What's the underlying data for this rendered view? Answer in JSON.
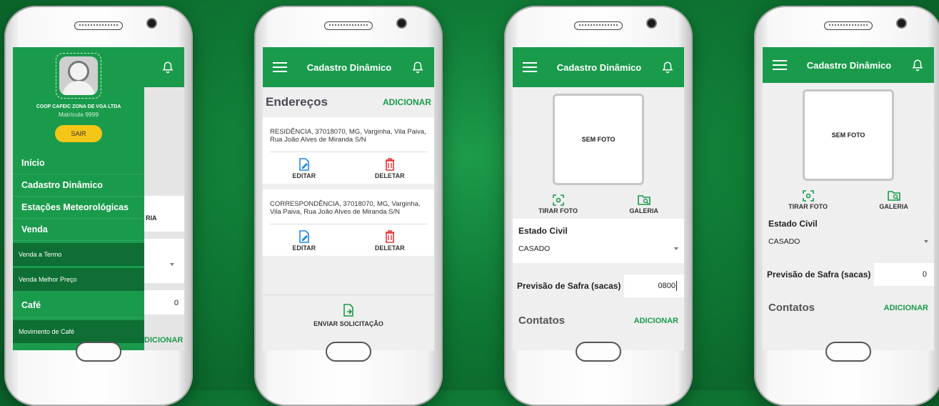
{
  "theme": {
    "primary": "#1a9b4c",
    "accent_button": "#f5c518",
    "delete_icon": "#e53935",
    "edit_icon": "#1e88e5"
  },
  "phone1": {
    "drawer": {
      "company": "COOP CAFEIC ZONA DE VGA LTDA",
      "matricula": "Matrícula 9999",
      "logout_label": "SAIR",
      "items": [
        {
          "label": "Início",
          "type": "main"
        },
        {
          "label": "Cadastro Dinâmico",
          "type": "main"
        },
        {
          "label": "Estações Meteorológicas",
          "type": "main"
        },
        {
          "label": "Venda",
          "type": "main"
        },
        {
          "label": "Venda a Termo",
          "type": "sub"
        },
        {
          "label": "Venda Melhor Preço",
          "type": "sub"
        },
        {
          "label": "Café",
          "type": "main"
        },
        {
          "label": "Movimento de Café",
          "type": "sub"
        }
      ]
    },
    "behind": {
      "galeria_fragment": "RIA",
      "value": "0",
      "adicionar_fragment": "DICIONAR"
    }
  },
  "phone2": {
    "header_title": "Cadastro Dinâmico",
    "section_title": "Endereços",
    "add_label": "ADICIONAR",
    "addresses": [
      {
        "text": "RESIDÊNCIA, 37018070, MG, Varginha, Vila Paiva, Rua João Alves de Miranda S/N"
      },
      {
        "text": "CORRESPONDÊNCIA, 37018070, MG, Varginha, Vila Paiva, Rua João Alves de Miranda S/N"
      }
    ],
    "edit_label": "EDITAR",
    "delete_label": "DELETAR",
    "send_label": "ENVIAR SOLICITAÇÃO"
  },
  "phone3": {
    "header_title": "Cadastro Dinâmico",
    "photo_placeholder": "SEM FOTO",
    "take_photo_label": "TIRAR FOTO",
    "gallery_label": "GALERIA",
    "estado_civil_label": "Estado Civil",
    "estado_civil_value": "CASADO",
    "safra_label": "Previsão de Safra (sacas)",
    "safra_value": "0800",
    "contatos_label": "Contatos",
    "add_label": "ADICIONAR"
  },
  "phone4": {
    "header_title": "Cadastro Dinâmico",
    "photo_placeholder": "SEM FOTO",
    "take_photo_label": "TIRAR FOTO",
    "gallery_label": "GALERIA",
    "estado_civil_label": "Estado Civil",
    "estado_civil_value": "CASADO",
    "safra_label": "Previsão de Safra (sacas)",
    "safra_value": "0",
    "contatos_label": "Contatos",
    "add_label": "ADICIONAR"
  }
}
